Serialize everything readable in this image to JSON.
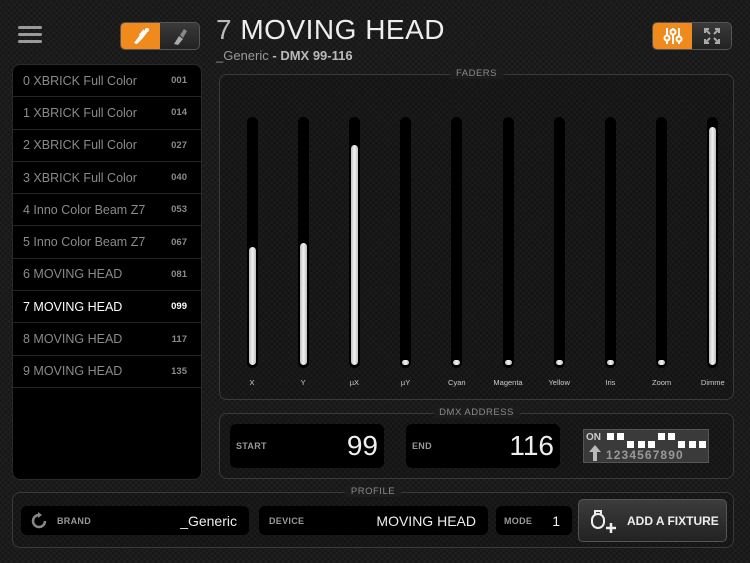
{
  "header": {
    "fixture_number": "7",
    "fixture_name": "MOVING HEAD",
    "brand": "_Generic",
    "dmx_range": "DMX 99-116"
  },
  "colors": {
    "accent": "#f08a1c",
    "background": "#1b1b1b"
  },
  "fixtures": [
    {
      "label": "0 XBRICK Full Color",
      "address": "001"
    },
    {
      "label": "1 XBRICK Full Color",
      "address": "014"
    },
    {
      "label": "2 XBRICK Full Color",
      "address": "027"
    },
    {
      "label": "3 XBRICK Full Color",
      "address": "040"
    },
    {
      "label": "4 Inno Color Beam Z7",
      "address": "053"
    },
    {
      "label": "5 Inno Color Beam Z7",
      "address": "067"
    },
    {
      "label": "6 MOVING HEAD",
      "address": "081"
    },
    {
      "label": "7 MOVING HEAD",
      "address": "099",
      "selected": true
    },
    {
      "label": "8 MOVING HEAD",
      "address": "117"
    },
    {
      "label": "9 MOVING HEAD",
      "address": "135"
    }
  ],
  "faders": {
    "title": "FADERS",
    "channels": [
      {
        "label": "X",
        "level": 0.48
      },
      {
        "label": "Y",
        "level": 0.5
      },
      {
        "label": "µX",
        "level": 0.9
      },
      {
        "label": "µY",
        "level": 0.02
      },
      {
        "label": "Cyan",
        "level": 0.02
      },
      {
        "label": "Magenta",
        "level": 0.02
      },
      {
        "label": "Yellow",
        "level": 0.02
      },
      {
        "label": "Iris",
        "level": 0.02
      },
      {
        "label": "Zoom",
        "level": 0.02
      },
      {
        "label": "Dimme",
        "level": 0.97
      }
    ]
  },
  "dmx": {
    "title": "DMX ADDRESS",
    "start_label": "START",
    "start_value": "99",
    "end_label": "END",
    "end_value": "116",
    "dip_on_label": "ON",
    "dip_numbers": "1234567890",
    "dip_states": [
      1,
      1,
      0,
      0,
      0,
      1,
      1,
      0,
      0,
      0
    ]
  },
  "profile": {
    "title": "PROFILE",
    "brand_label": "BRAND",
    "brand_value": "_Generic",
    "device_label": "DEVICE",
    "device_value": "MOVING HEAD",
    "mode_label": "MODE",
    "mode_value": "1",
    "add_button": "ADD A FIXTURE"
  },
  "icons": {
    "menu": "hamburger-icon",
    "edit_fixture": "fixture-edit-icon",
    "cleanup": "brush-icon",
    "faders": "sliders-icon",
    "fullscreen": "expand-icon",
    "refresh": "refresh-icon",
    "add_fixture": "add-fixture-icon"
  }
}
